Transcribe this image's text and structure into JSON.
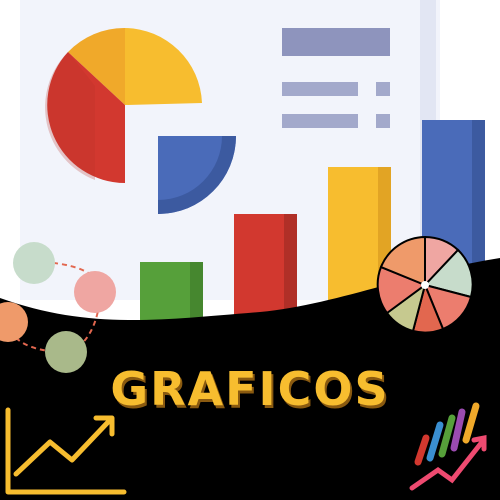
{
  "title": "GRAFICOS",
  "colors": {
    "background": "#ffffff",
    "board": "#f2f4fb",
    "board_edge": "#e2e6f3",
    "yellow": "#f7bd2f",
    "red": "#d2382f",
    "blue": "#4a6bb9",
    "green": "#56a03a",
    "lines": "#8e94bd",
    "black_band": "#000000"
  },
  "icons": [
    "pie-chart-icon",
    "bar-chart-icon",
    "trend-arrow-icon",
    "colorful-graph-icon",
    "donut-chart-icon",
    "connected-dots-icon"
  ]
}
